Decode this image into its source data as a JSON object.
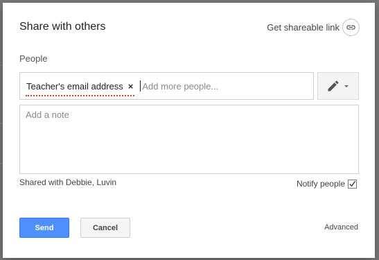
{
  "dialog": {
    "title": "Share with others",
    "share_link_label": "Get shareable link",
    "people_label": "People",
    "recipient_chip": "Teacher's email address",
    "chip_remove": "×",
    "people_placeholder": "Add more people...",
    "note_placeholder": "Add a note",
    "shared_with": "Shared with Debbie, Luvin",
    "notify_label": "Notify people",
    "notify_checked": true,
    "send_label": "Send",
    "cancel_label": "Cancel",
    "advanced_label": "Advanced"
  },
  "icons": {
    "link": "link-icon",
    "permission": "pencil-icon",
    "dropdown": "caret-down-icon",
    "check": "check-icon"
  },
  "colors": {
    "primary": "#4d90fe",
    "spellcheck_underline": "#d23f31"
  }
}
